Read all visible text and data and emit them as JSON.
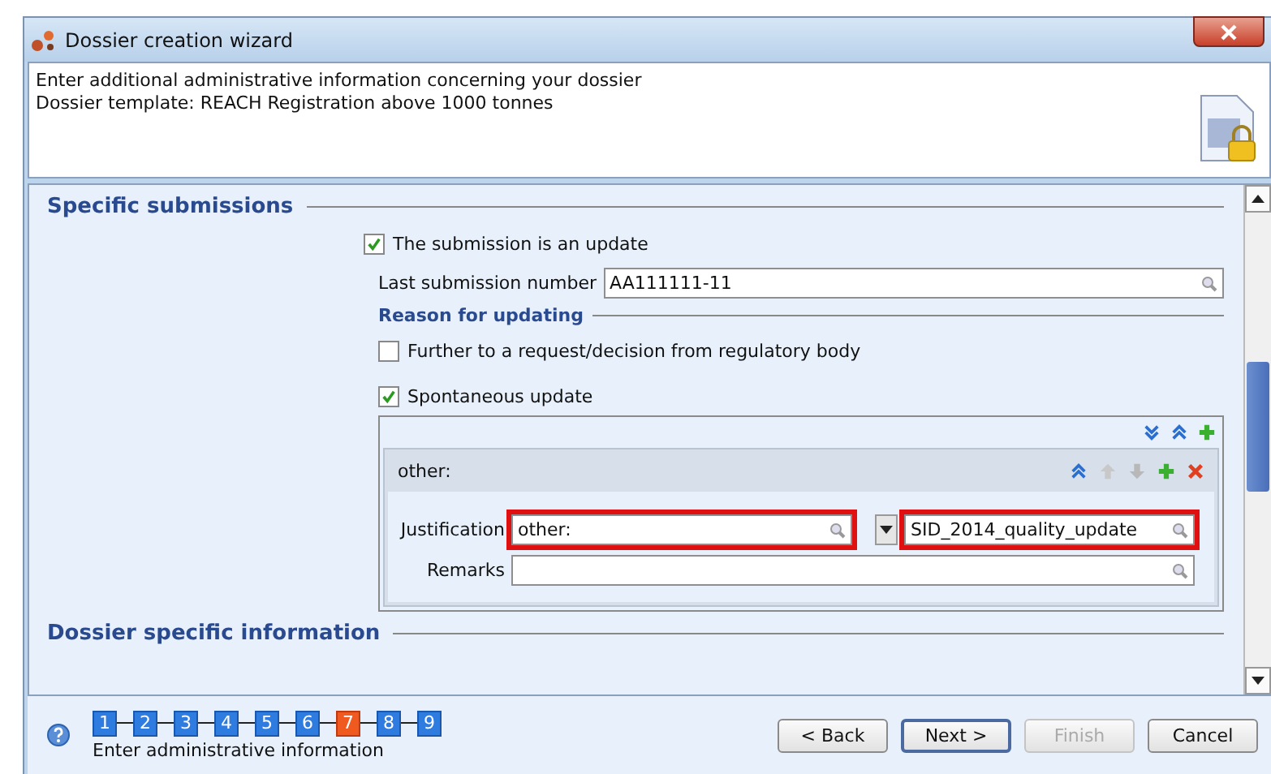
{
  "window": {
    "title": "Dossier creation wizard"
  },
  "header": {
    "lines": [
      "Enter additional administrative information concerning your dossier",
      "Dossier template: REACH Registration above 1000 tonnes"
    ]
  },
  "sections": [
    {
      "title": "Specific submissions"
    },
    {
      "title": "Dossier specific information"
    }
  ],
  "update": {
    "label": "The submission is an update",
    "checked": true,
    "last_submission": {
      "label": "Last submission number",
      "value": "AA111111-11"
    },
    "reason_heading": "Reason for updating",
    "reasons": [
      {
        "label": "Further to a request/decision from regulatory body",
        "checked": false
      },
      {
        "label": "Spontaneous update",
        "checked": true
      }
    ],
    "entry": {
      "title": "other:",
      "justification": {
        "label": "Justification",
        "value": "other:",
        "highlighted": true,
        "detail": "SID_2014_quality_update",
        "detail_highlighted": true
      },
      "remarks": {
        "label": "Remarks"
      }
    }
  },
  "steps": [
    {
      "label": "1",
      "selected": false
    },
    {
      "label": "2",
      "selected": false
    },
    {
      "label": "3",
      "selected": false
    },
    {
      "label": "4",
      "selected": false
    },
    {
      "label": "5",
      "selected": false
    },
    {
      "label": "6",
      "selected": false
    },
    {
      "label": "7",
      "selected": true
    },
    {
      "label": "8",
      "selected": false
    },
    {
      "label": "9",
      "selected": false
    }
  ],
  "step_caption": "Enter administrative information",
  "buttons": [
    {
      "label": "< Back",
      "disabled": false,
      "default": false
    },
    {
      "label": "Next >",
      "disabled": false,
      "default": true
    },
    {
      "label": "Finish",
      "disabled": true,
      "default": false
    },
    {
      "label": "Cancel",
      "disabled": false,
      "default": false
    }
  ]
}
